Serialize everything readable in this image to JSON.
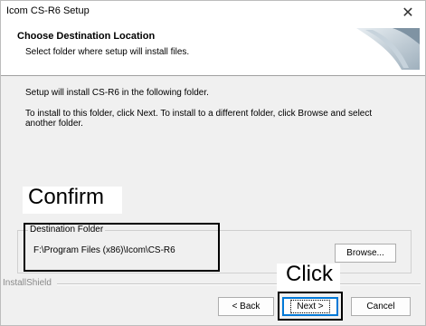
{
  "window": {
    "title": "Icom CS-R6 Setup",
    "close_glyph": "✕"
  },
  "header": {
    "title": "Choose Destination Location",
    "subtitle": "Select folder where setup will install files."
  },
  "body": {
    "line1": "Setup will install CS-R6 in the following folder.",
    "line2": "To install to this folder, click Next. To install to a different folder, click Browse and select",
    "line3": "another folder."
  },
  "destination": {
    "legend": "Destination Folder",
    "path": "F:\\Program Files (x86)\\Icom\\CS-R6"
  },
  "buttons": {
    "browse": "Browse...",
    "back": "< Back",
    "next": "Next >",
    "cancel": "Cancel"
  },
  "footer": {
    "brand": "InstallShield"
  },
  "annotations": {
    "confirm": "Confirm",
    "click": "Click"
  }
}
